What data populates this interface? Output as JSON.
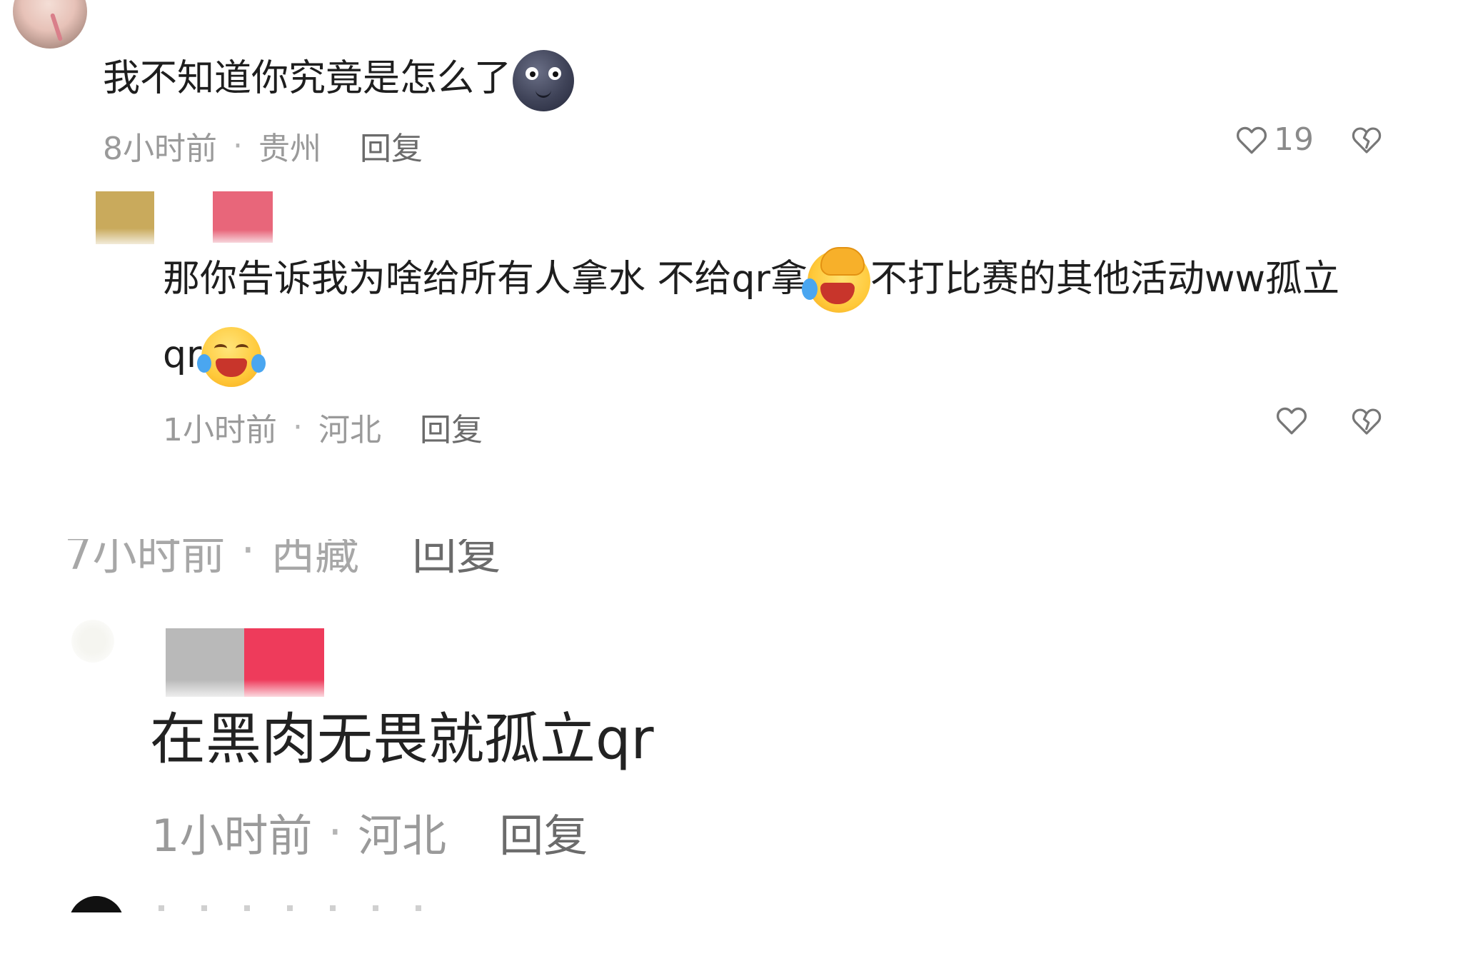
{
  "comments": [
    {
      "text": "我不知道你究竟是怎么了",
      "emoji": "new-moon-face",
      "time": "8小时前",
      "location": "贵州",
      "reply_label": "回复",
      "like_count": "19"
    },
    {
      "text_line1_a": "那你告诉我为啥给所有人拿水 不给qr拿",
      "text_line1_b": "不打比赛的其他活动ww孤立",
      "text_line2": "qr",
      "emojis": [
        "face-palm-crying",
        "face-with-tears-of-joy"
      ],
      "time": "1小时前",
      "location": "河北",
      "reply_label": "回复",
      "like_count": ""
    },
    {
      "time": "7小时前",
      "location": "西藏",
      "reply_label": "回复"
    },
    {
      "text": "在黑肉无畏就孤立qr",
      "time": "1小时前",
      "location": "河北",
      "reply_label": "回复"
    }
  ],
  "separator": "·",
  "icons": [
    "heart-icon",
    "broken-heart-icon"
  ],
  "colors": {
    "meta_gray": "#9a9a9a",
    "reply_gray": "#6b6b6b",
    "censor_gold": "#c9aa5c",
    "censor_pink": "#e8667a",
    "censor_gray": "#b9b9b9",
    "censor_red": "#ee3b5b"
  }
}
